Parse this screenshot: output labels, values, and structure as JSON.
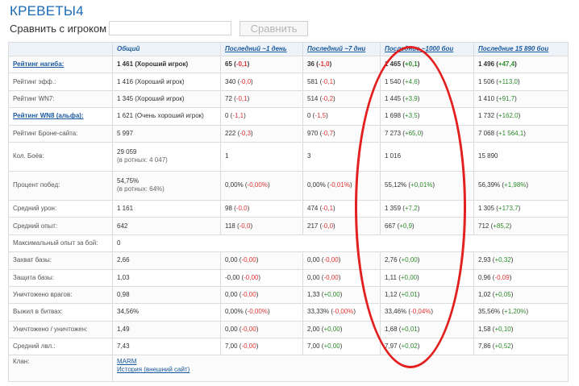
{
  "page": {
    "title": "КРЕВЕТЫ4",
    "compare_label": "Сравнить с игроком",
    "compare_placeholder": "",
    "compare_button": "Сравнить"
  },
  "table": {
    "headers": [
      "",
      "Общий",
      "Последний ~1 день",
      "Последний ~7 дни",
      "Последние ~1000 бои",
      "Последние 15 890 бои"
    ],
    "rows": [
      {
        "label": "Рейтинг нагиба:",
        "label_link": true,
        "c1": {
          "main": "1 461 (Хороший игрок)",
          "bold": true
        },
        "c2": {
          "main": "65 (",
          "delta": "-0,1",
          "sign": "neg",
          "tail": ")"
        },
        "c3": {
          "main": "36 (",
          "delta": "-1,0",
          "sign": "neg",
          "tail": ")"
        },
        "c4": {
          "main": "1 465 (",
          "delta": "+0,1",
          "sign": "pos",
          "tail": ")"
        },
        "c5": {
          "main": "1 496 (",
          "delta": "+47,4",
          "sign": "pos",
          "tail": ")"
        },
        "bold_row": true
      },
      {
        "label": "Рейтинг эфф.:",
        "c1": {
          "main": "1 416 (Хороший игрок)"
        },
        "c2": {
          "main": "340 (",
          "delta": "-0,0",
          "sign": "neg",
          "tail": ")"
        },
        "c3": {
          "main": "581 (",
          "delta": "-0,1",
          "sign": "neg",
          "tail": ")"
        },
        "c4": {
          "main": "1 540 (",
          "delta": "+4,6",
          "sign": "pos",
          "tail": ")"
        },
        "c5": {
          "main": "1 506 (",
          "delta": "+113,0",
          "sign": "pos",
          "tail": ")"
        }
      },
      {
        "label": "Рейтинг WN7:",
        "c1": {
          "main": "1 345 (Хороший игрок)"
        },
        "c2": {
          "main": "72 (",
          "delta": "-0,1",
          "sign": "neg",
          "tail": ")"
        },
        "c3": {
          "main": "514 (",
          "delta": "-0,2",
          "sign": "neg",
          "tail": ")"
        },
        "c4": {
          "main": "1 445 (",
          "delta": "+3,9",
          "sign": "pos",
          "tail": ")"
        },
        "c5": {
          "main": "1 410 (",
          "delta": "+91,7",
          "sign": "pos",
          "tail": ")"
        }
      },
      {
        "label": "Рейтинг WN8 (альфа):",
        "label_link": true,
        "c1": {
          "main": "1 621 (Очень хороший игрок)"
        },
        "c2": {
          "main": "0 (",
          "delta": "-1,1",
          "sign": "neg",
          "tail": ")"
        },
        "c3": {
          "main": "0 (",
          "delta": "-1,5",
          "sign": "neg",
          "tail": ")"
        },
        "c4": {
          "main": "1 698 (",
          "delta": "+3,5",
          "sign": "pos",
          "tail": ")"
        },
        "c5": {
          "main": "1 732 (",
          "delta": "+162,0",
          "sign": "pos",
          "tail": ")"
        }
      },
      {
        "label": "Рейтинг Броне-сайта:",
        "c1": {
          "main": "5 997"
        },
        "c2": {
          "main": "222 (",
          "delta": "-0,3",
          "sign": "neg",
          "tail": ")"
        },
        "c3": {
          "main": "970 (",
          "delta": "-0,7",
          "sign": "neg",
          "tail": ")"
        },
        "c4": {
          "main": "7 273 (",
          "delta": "+65,0",
          "sign": "pos",
          "tail": ")"
        },
        "c5": {
          "main": "7 068 (",
          "delta": "+1 564,1",
          "sign": "pos",
          "tail": ")"
        }
      },
      {
        "label": "Кол. Боёв:",
        "tall": true,
        "c1": {
          "main": "29 059",
          "sub": "(в ротных: 4 047)"
        },
        "c2": {
          "main": "1"
        },
        "c3": {
          "main": "3"
        },
        "c4": {
          "main": "1 016"
        },
        "c5": {
          "main": "15 890"
        }
      },
      {
        "label": "Процент побед:",
        "tall": true,
        "c1": {
          "main": "54,75%",
          "sub": "(в ротных: 64%)"
        },
        "c2": {
          "main": "0,00% (",
          "delta": "-0,00%",
          "sign": "neg",
          "tail": ")"
        },
        "c3": {
          "main": "0,00% (",
          "delta": "-0,01%",
          "sign": "neg",
          "tail": ")"
        },
        "c4": {
          "main": "55,12% (",
          "delta": "+0,01%",
          "sign": "pos",
          "tail": ")"
        },
        "c5": {
          "main": "56,39% (",
          "delta": "+1,98%",
          "sign": "pos",
          "tail": ")"
        }
      },
      {
        "label": "Средний урон:",
        "c1": {
          "main": "1 161"
        },
        "c2": {
          "main": "98 (",
          "delta": "-0,0",
          "sign": "neg",
          "tail": ")"
        },
        "c3": {
          "main": "474 (",
          "delta": "-0,1",
          "sign": "neg",
          "tail": ")"
        },
        "c4": {
          "main": "1 359 (",
          "delta": "+7,2",
          "sign": "pos",
          "tail": ")"
        },
        "c5": {
          "main": "1 305 (",
          "delta": "+173,7",
          "sign": "pos",
          "tail": ")"
        }
      },
      {
        "label": "Средний опыт:",
        "c1": {
          "main": "642"
        },
        "c2": {
          "main": "118 (",
          "delta": "-0,0",
          "sign": "neg",
          "tail": ")"
        },
        "c3": {
          "main": "217 (",
          "delta": "-0,0",
          "sign": "neg",
          "tail": ")"
        },
        "c4": {
          "main": "667 (",
          "delta": "+0,9",
          "sign": "pos",
          "tail": ")"
        },
        "c5": {
          "main": "712 (",
          "delta": "+85,2",
          "sign": "pos",
          "tail": ")"
        }
      },
      {
        "label": "Максимальный опыт за бой:",
        "span": true,
        "c1": {
          "main": "0"
        }
      },
      {
        "label": "Захват базы:",
        "c1": {
          "main": "2,66"
        },
        "c2": {
          "main": "0,00 (",
          "delta": "-0,00",
          "sign": "neg",
          "tail": ")"
        },
        "c3": {
          "main": "0,00 (",
          "delta": "-0,00",
          "sign": "neg",
          "tail": ")"
        },
        "c4": {
          "main": "2,76 (",
          "delta": "+0,00",
          "sign": "pos",
          "tail": ")"
        },
        "c5": {
          "main": "2,93 (",
          "delta": "+0,32",
          "sign": "pos",
          "tail": ")"
        }
      },
      {
        "label": "Защита базы:",
        "c1": {
          "main": "1,03"
        },
        "c2": {
          "main": "-0,00 (",
          "delta": "-0,00",
          "sign": "neg",
          "tail": ")"
        },
        "c3": {
          "main": "0,00 (",
          "delta": "-0,00",
          "sign": "neg",
          "tail": ")"
        },
        "c4": {
          "main": "1,11 (",
          "delta": "+0,00",
          "sign": "pos",
          "tail": ")"
        },
        "c5": {
          "main": "0,96 (",
          "delta": "-0,09",
          "sign": "neg",
          "tail": ")"
        }
      },
      {
        "label": "Уничтожено врагов:",
        "c1": {
          "main": "0,98"
        },
        "c2": {
          "main": "0,00 (",
          "delta": "-0,00",
          "sign": "neg",
          "tail": ")"
        },
        "c3": {
          "main": "1,33 (",
          "delta": "+0,00",
          "sign": "pos",
          "tail": ")"
        },
        "c4": {
          "main": "1,12 (",
          "delta": "+0,01",
          "sign": "pos",
          "tail": ")"
        },
        "c5": {
          "main": "1,02 (",
          "delta": "+0,05",
          "sign": "pos",
          "tail": ")"
        }
      },
      {
        "label": "Выжил в битвах:",
        "c1": {
          "main": "34,56%"
        },
        "c2": {
          "main": "0,00% (",
          "delta": "-0,00%",
          "sign": "neg",
          "tail": ")"
        },
        "c3": {
          "main": "33,33% (",
          "delta": "-0,00%",
          "sign": "neg",
          "tail": ")"
        },
        "c4": {
          "main": "33,46% (",
          "delta": "-0,04%",
          "sign": "neg",
          "tail": ")"
        },
        "c5": {
          "main": "35,56% (",
          "delta": "+1,20%",
          "sign": "pos",
          "tail": ")"
        }
      },
      {
        "label": "Уничтожено / уничтожен:",
        "c1": {
          "main": "1,49"
        },
        "c2": {
          "main": "0,00 (",
          "delta": "-0,00",
          "sign": "neg",
          "tail": ")"
        },
        "c3": {
          "main": "2,00 (",
          "delta": "+0,00",
          "sign": "pos",
          "tail": ")"
        },
        "c4": {
          "main": "1,68 (",
          "delta": "+0,01",
          "sign": "pos",
          "tail": ")"
        },
        "c5": {
          "main": "1,58 (",
          "delta": "+0,10",
          "sign": "pos",
          "tail": ")"
        }
      },
      {
        "label": "Средний лвл.:",
        "c1": {
          "main": "7,43"
        },
        "c2": {
          "main": "7,00 (",
          "delta": "-0,00",
          "sign": "neg",
          "tail": ")"
        },
        "c3": {
          "main": "7,00 (",
          "delta": "+0,00",
          "sign": "pos",
          "tail": ")"
        },
        "c4": {
          "main": "7,97 (",
          "delta": "+0,02",
          "sign": "pos",
          "tail": ")"
        },
        "c5": {
          "main": "7,86 (",
          "delta": "+0,52",
          "sign": "pos",
          "tail": ")"
        }
      }
    ],
    "clan": {
      "label": "Клан:",
      "link1": "MARM",
      "link2": "История (внешний сайт)"
    }
  },
  "colors": {
    "accent": "#1a6bb8",
    "negative": "#d33333",
    "positive": "#2e8b2e",
    "annotation": "#e32020"
  }
}
